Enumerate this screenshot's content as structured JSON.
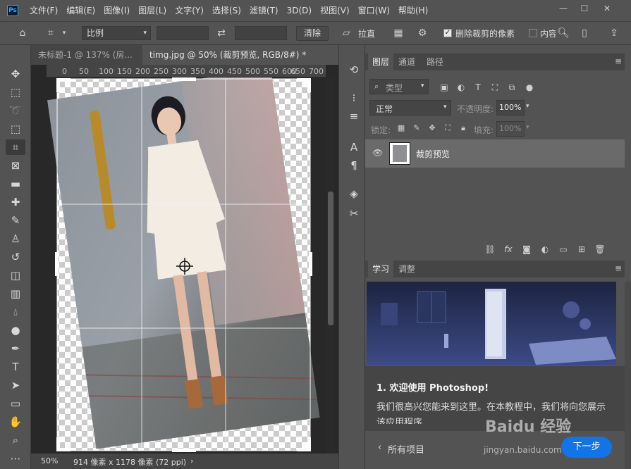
{
  "app": {
    "logo": "Ps"
  },
  "menu": [
    "文件(F)",
    "编辑(E)",
    "图像(I)",
    "图层(L)",
    "文字(Y)",
    "选择(S)",
    "滤镜(T)",
    "3D(D)",
    "视图(V)",
    "窗口(W)",
    "帮助(H)"
  ],
  "window_controls": {
    "minimize": "—",
    "restore": "☐",
    "close": "✕"
  },
  "options": {
    "ratio_value": "比例",
    "clear_label": "清除",
    "straighten_label": "拉直",
    "delete_cropped_label": "删除裁剪的像素",
    "content_label": "内容"
  },
  "tabs": [
    {
      "label": "未标题-1 @ 137% (房..."
    },
    {
      "label": "timg.jpg @ 50% (裁剪预览, RGB/8#) *"
    }
  ],
  "ruler_ticks": [
    "0",
    "50",
    "100",
    "150",
    "200",
    "250",
    "300",
    "350",
    "400",
    "450",
    "500",
    "550",
    "600",
    "650",
    "700"
  ],
  "status": {
    "zoom": "50%",
    "dimensions": "914 像素 x 1178 像素 (72 ppi)"
  },
  "layers_panel": {
    "tabs": [
      "图层",
      "通道",
      "路径"
    ],
    "filter_placeholder": "类型",
    "blend_mode": "正常",
    "opacity_label": "不透明度:",
    "opacity_value": "100%",
    "lock_label": "锁定:",
    "fill_label": "填充:",
    "fill_value": "100%",
    "layer_name": "裁剪预览"
  },
  "learn_panel": {
    "tabs": [
      "学习",
      "调整"
    ],
    "heading": "1. 欢迎使用 Photoshop!",
    "body": "我们很高兴您能来到这里。在本教程中，我们将向您展示该应用程序",
    "all_items": "所有项目",
    "next_button": "下一步"
  },
  "watermark": {
    "brand": "Baidu 经验",
    "url": "jingyan.baidu.com"
  },
  "colors": {
    "accent": "#31a8ff",
    "panel": "#535353",
    "dark": "#282828"
  }
}
